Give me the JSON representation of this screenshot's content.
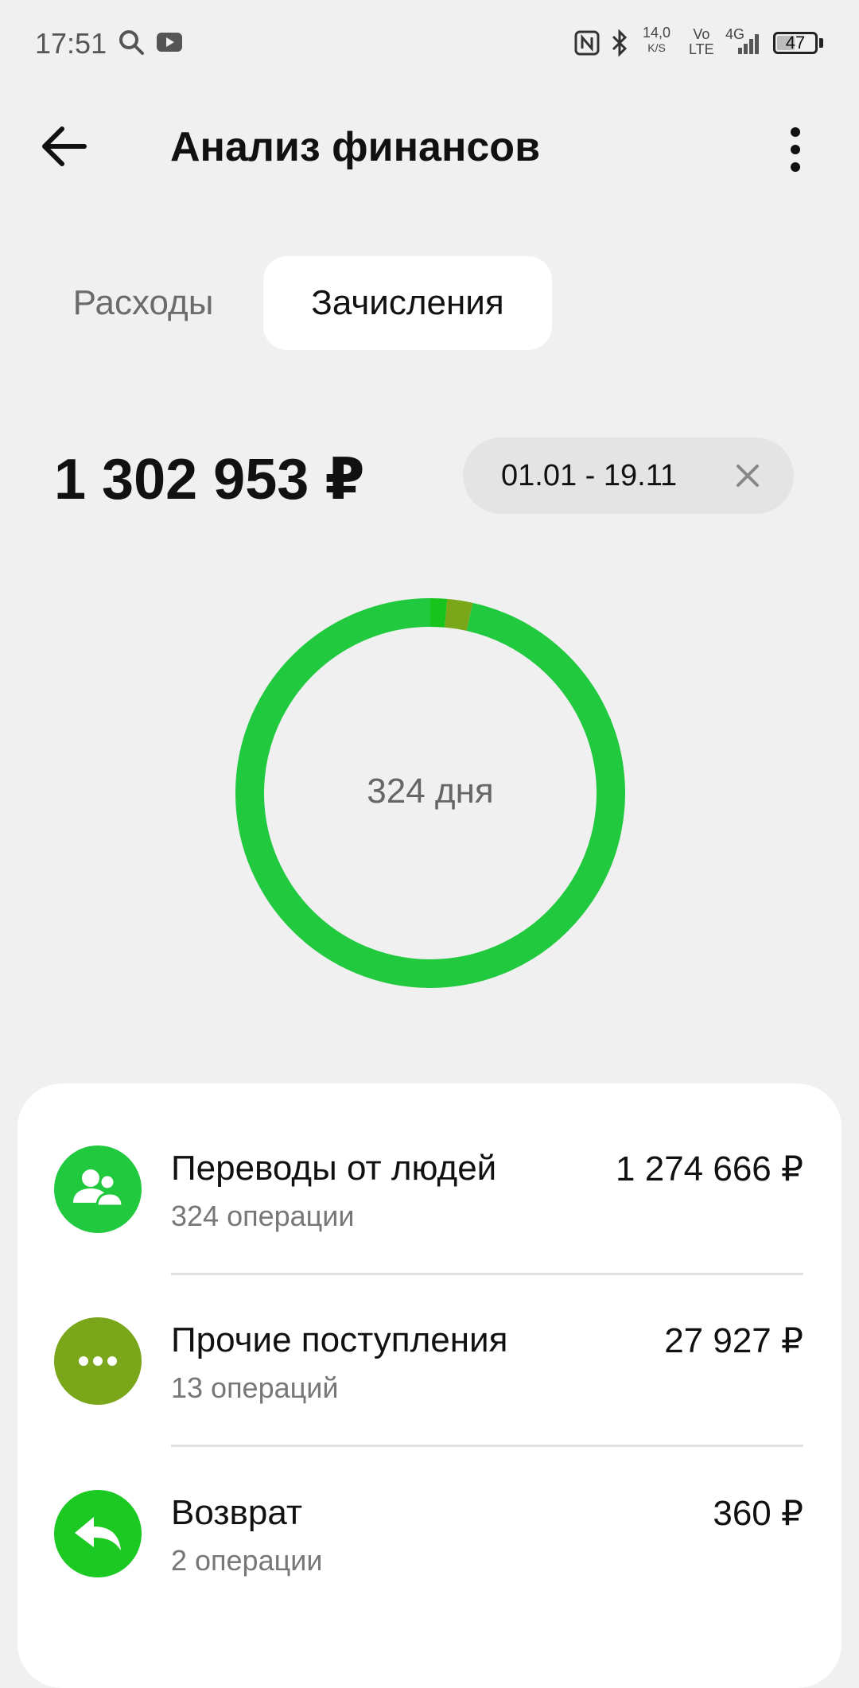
{
  "status_bar": {
    "time": "17:51",
    "speed_value": "14,0",
    "speed_unit": "K/S",
    "volte_top": "Vo",
    "volte_bottom": "LTE",
    "network": "4G",
    "battery": "47",
    "battery_level": 0.47
  },
  "header": {
    "title": "Анализ финансов"
  },
  "tabs": [
    {
      "label": "Расходы",
      "active": false
    },
    {
      "label": "Зачисления",
      "active": true
    }
  ],
  "summary": {
    "total": "1 302 953 ₽",
    "period": "01.01 - 19.11"
  },
  "donut": {
    "center_label": "324 дня",
    "segments": [
      {
        "value": 1274666,
        "color": "#21c93f"
      },
      {
        "value": 27927,
        "color": "#7aa61a"
      },
      {
        "value": 360,
        "color": "#17c41c"
      }
    ],
    "visual_segments_note_free": true
  },
  "categories": [
    {
      "name": "Переводы от людей",
      "count": "324 операции",
      "amount": "1 274 666 ₽",
      "icon": "people-icon",
      "color": "#21c93f"
    },
    {
      "name": "Прочие поступления",
      "count": "13 операций",
      "amount": "27 927 ₽",
      "icon": "more-dots-icon",
      "color": "#7aa61a"
    },
    {
      "name": "Возврат",
      "count": "2 операции",
      "amount": "360 ₽",
      "icon": "return-arrow-icon",
      "color": "#1cc923"
    }
  ]
}
